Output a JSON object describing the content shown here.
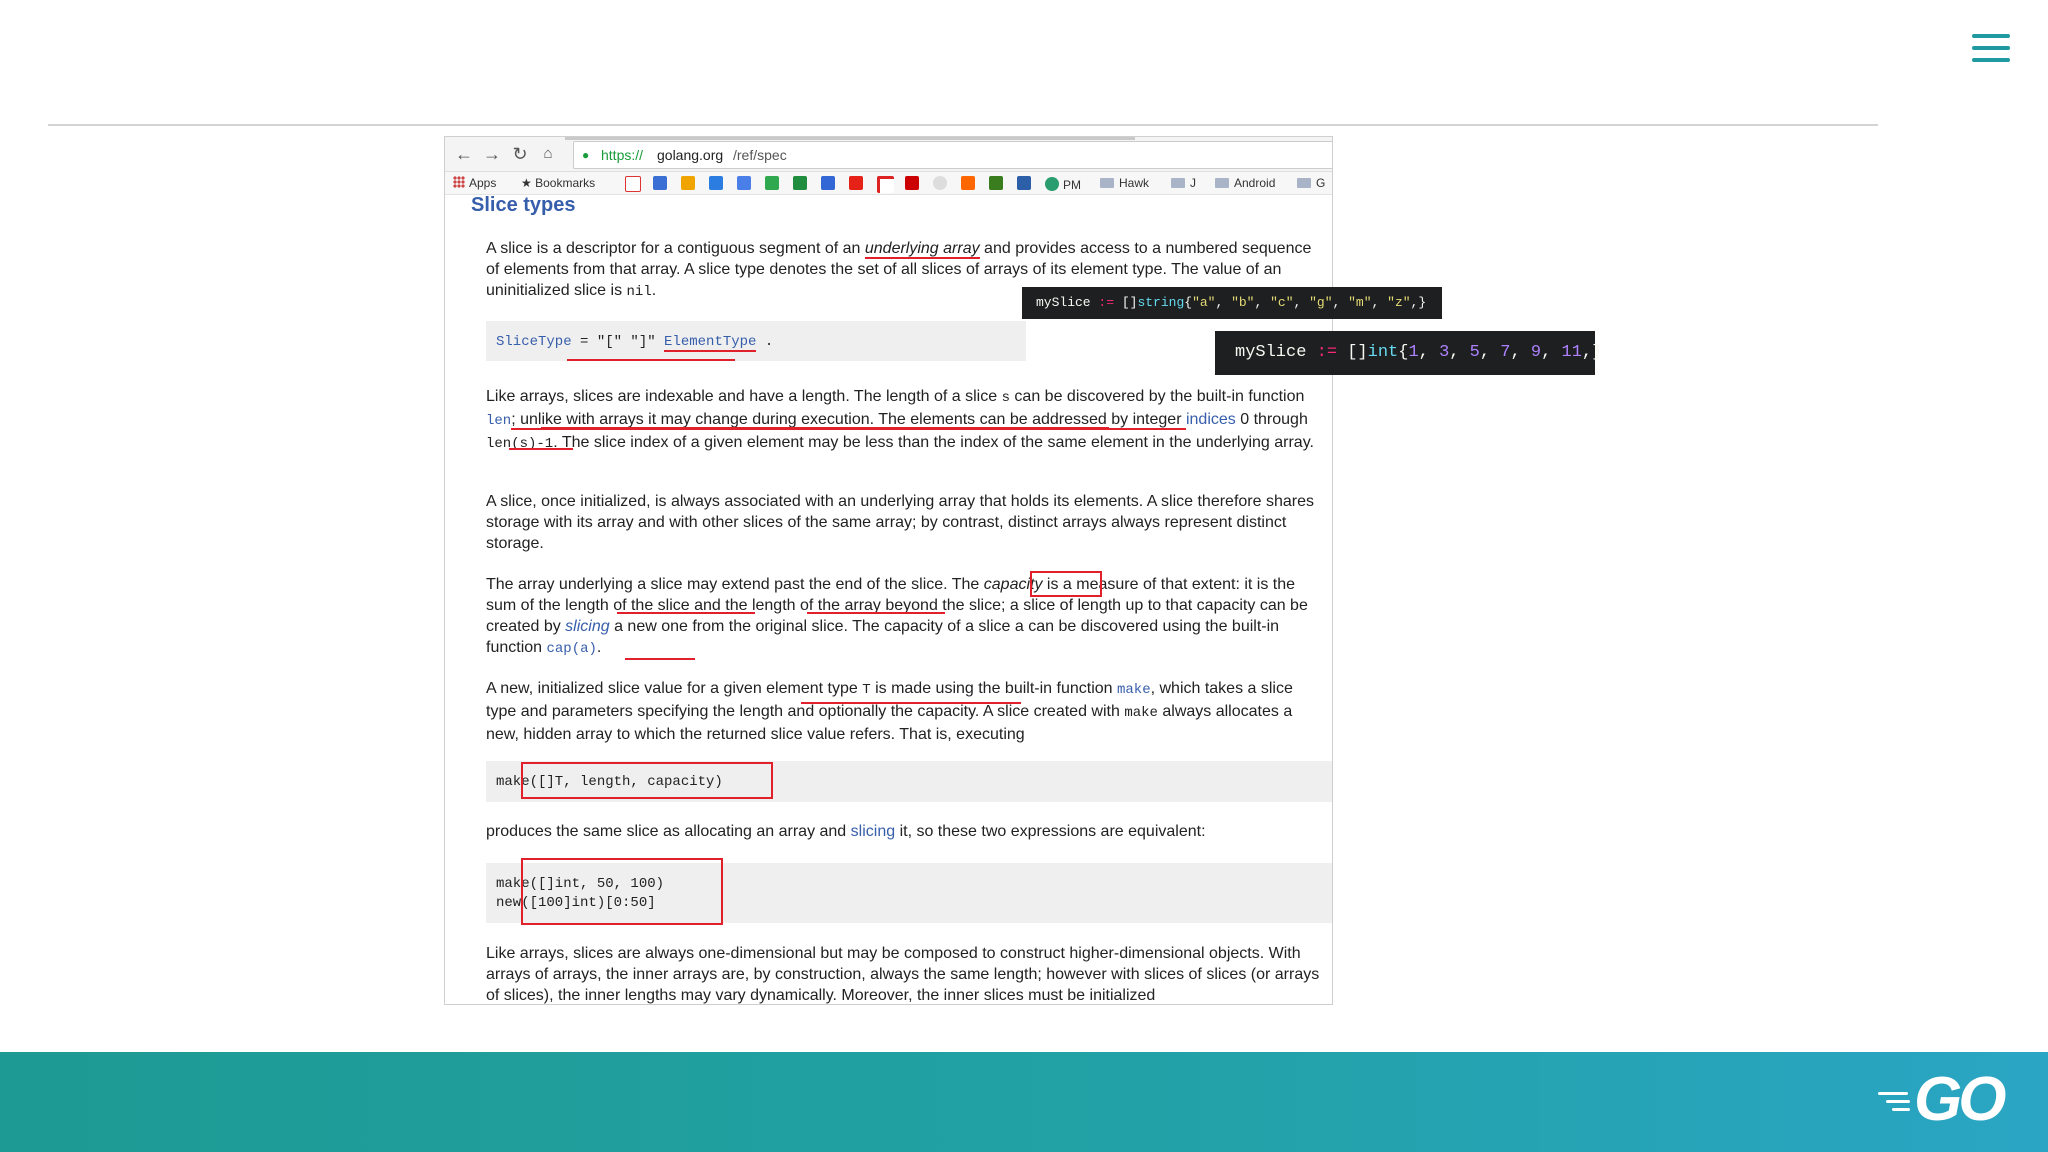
{
  "browser": {
    "url_protocol": "https://",
    "url_domain": "golang.org",
    "url_path": "/ref/spec",
    "bookmarks": [
      "Apps",
      "Bookmarks",
      "PM",
      "Hawk",
      "J",
      "Android",
      "G"
    ]
  },
  "doc": {
    "heading": "Slice types",
    "p1": [
      "A slice is a descriptor for a contiguous segment of an ",
      "underlying array",
      " and provides access to a numbered sequence of elements from that array. A slice type denotes the set of all slices of arrays of its element type. The value of an uninitialized slice is ",
      "nil",
      "."
    ],
    "grammar": [
      "SliceType",
      " = \"[\" \"]\" ",
      "ElementType",
      " ."
    ],
    "p2": [
      "Like arrays, slices are indexable and have a length. The length of a slice ",
      "s",
      " can be discovered by the built-in function ",
      "len",
      "; unlike with arrays it may change during execution. The elements can be addressed by integer ",
      "indices",
      " 0 through ",
      "len(s)-1",
      ". The slice index of a given element may be less than the index of the same element in the underlying array."
    ],
    "p3": "A slice, once initialized, is always associated with an underlying array that holds its elements. A slice therefore shares storage with its array and with other slices of the same array; by contrast, distinct arrays always represent distinct storage.",
    "p4": [
      "The array underlying a slice may extend past the end of the slice. The ",
      "capacity",
      " is a measure of that extent: it is the sum of the length of the slice and the length of the array beyond the slice; a slice of length up to that capacity can be created by ",
      "slicing",
      " a new one from the original slice. The capacity of a slice ",
      "a",
      " can be discovered using the built-in function ",
      "cap(a)",
      "."
    ],
    "p5": [
      "A new, initialized slice value for a given element type ",
      "T",
      " is made using the built-in function ",
      "make",
      ", which takes a slice type and parameters specifying the length and optionally the capacity. A slice created with ",
      "make",
      " always allocates a new, hidden array to which the returned slice value refers. That is, executing"
    ],
    "code1": "make([]T, length, capacity)",
    "p6": [
      "produces the same slice as allocating an array and ",
      "slicing",
      " it, so these two expressions are equivalent:"
    ],
    "code2": [
      "make([]int, 50, 100)",
      "new([100]int)[0:50]"
    ],
    "p7": "Like arrays, slices are always one-dimensional but may be composed to construct higher-dimensional objects. With arrays of arrays, the inner arrays are, by construction, always the same length; however with slices of slices (or arrays of slices), the inner lengths may vary dynamically. Moreover, the inner slices must be initialized"
  },
  "tooltips": {
    "string_slice": [
      "mySlice",
      " := ",
      "[]",
      "string",
      "{",
      "\"a\"",
      ", ",
      "\"b\"",
      ", ",
      "\"c\"",
      ", ",
      "\"g\"",
      ", ",
      "\"m\"",
      ", ",
      "\"z\"",
      ",}"
    ],
    "int_slice": [
      "mySlice",
      " := ",
      "[]",
      "int",
      "{",
      "1",
      ", ",
      "3",
      ", ",
      "5",
      ", ",
      "7",
      ", ",
      "9",
      ", ",
      "11",
      ",}"
    ]
  },
  "logo": {
    "text": "GO"
  },
  "colors": {
    "accent": "#1e9aa0",
    "link": "#375eab",
    "annotation": "#e0202a",
    "tooltip_bg": "#1d1f21"
  },
  "icons": [
    "menu-icon",
    "back-arrow-icon",
    "forward-arrow-icon",
    "reload-icon",
    "home-icon",
    "lock-icon",
    "apps-grid-icon",
    "star-icon",
    "folder-icon",
    "go-gopher-speed-icon"
  ]
}
